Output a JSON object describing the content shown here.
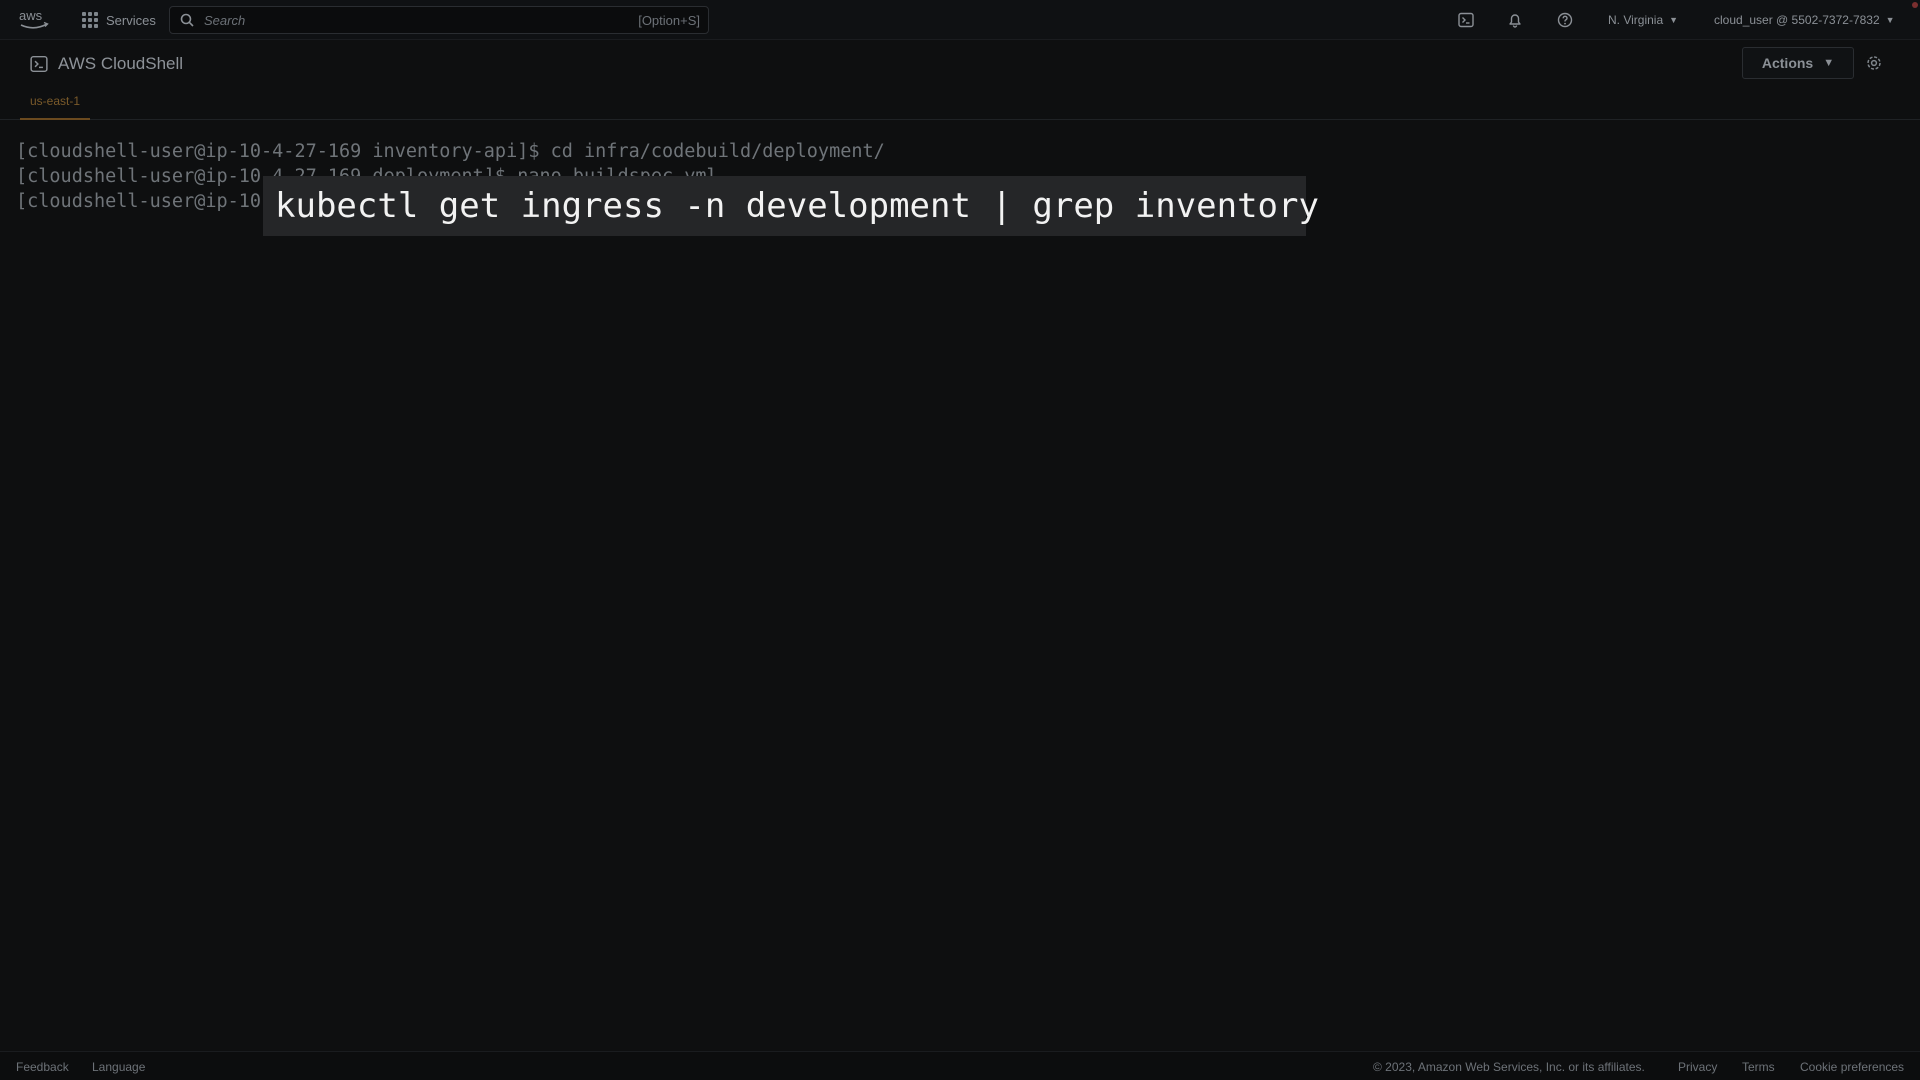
{
  "topnav": {
    "logo": "aws",
    "services_label": "Services",
    "search_placeholder": "Search",
    "search_shortcut": "[Option+S]",
    "icons": [
      "cloudshell-icon",
      "bell-icon",
      "help-icon"
    ],
    "region_label": "N. Virginia",
    "account_label": "cloud_user @ 5502-7372-7832"
  },
  "cloudshell": {
    "title": "AWS CloudShell",
    "tabs": [
      {
        "label": "us-east-1"
      }
    ],
    "actions_label": "Actions"
  },
  "terminal": {
    "lines": [
      "[cloudshell-user@ip-10-4-27-169 inventory-api]$ cd infra/codebuild/deployment/",
      "[cloudshell-user@ip-10-4-27-169 deployment]$ nano buildspec.yml",
      "[cloudshell-user@ip-10-"
    ],
    "overlay_command": "kubectl get ingress -n development | grep inventory"
  },
  "footer": {
    "feedback": "Feedback",
    "language": "Language",
    "copyright": "© 2023, Amazon Web Services, Inc. or its affiliates.",
    "privacy": "Privacy",
    "terms": "Terms",
    "cookie": "Cookie preferences"
  },
  "colors": {
    "background": "#0e0f10",
    "tab_accent": "#6b4a1f",
    "overlay_bg": "#252628"
  }
}
